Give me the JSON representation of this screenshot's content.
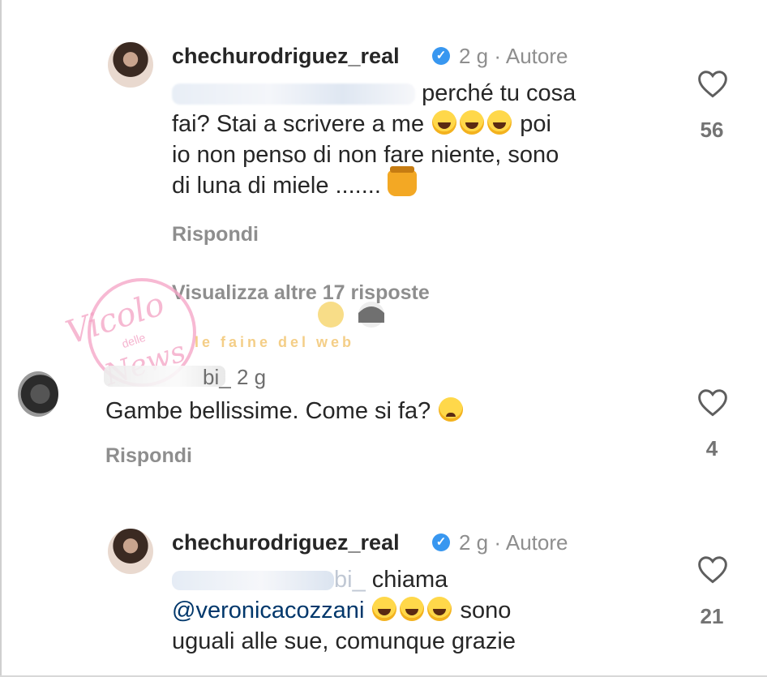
{
  "colors": {
    "text": "#262626",
    "secondary": "#8e8e8e",
    "mention": "#00376b",
    "verified": "#3897f0"
  },
  "comments": [
    {
      "username": "chechurodriguez_real",
      "verified": true,
      "time": "2 g",
      "separator": "·",
      "role": "Autore",
      "text_line1": "perché tu cosa",
      "text_line2a": "fai? Stai a scrivere a me",
      "text_line2b": "poi",
      "text_line3": "io non penso di non fare niente, sono",
      "text_line4": "di luna di miele .......",
      "reply_label": "Rispondi",
      "likes": "56",
      "like_icon": "heart-outline-icon"
    },
    {
      "username_visible_part": "bi_",
      "time": "2 g",
      "text": "Gambe bellissime. Come si fa?",
      "reply_label": "Rispondi",
      "likes": "4",
      "like_icon": "heart-outline-icon"
    },
    {
      "username": "chechurodriguez_real",
      "verified": true,
      "time": "2 g",
      "separator": "·",
      "role": "Autore",
      "mention_tail": "bi_",
      "text_line1": "chiama",
      "mention": "@veronicacozzani",
      "text_line2b": "sono",
      "text_line3": "uguali alle sue, comunque grazie",
      "likes": "21",
      "like_icon": "heart-outline-icon"
    }
  ],
  "view_more": "Visualizza altre 17 risposte",
  "watermark": {
    "main": "Vicolo",
    "sub": "delle",
    "news": "News",
    "secondary": "le faine del web"
  }
}
